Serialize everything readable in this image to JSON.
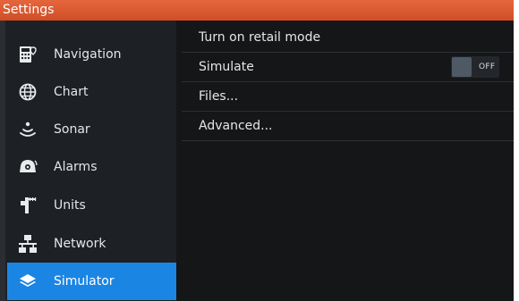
{
  "window": {
    "title": "Settings",
    "accent_color": "#d95a31",
    "selected_color": "#1b85e4"
  },
  "sidebar": {
    "items": [
      {
        "label": "Navigation",
        "icon": "navigation-icon"
      },
      {
        "label": "Chart",
        "icon": "globe-icon"
      },
      {
        "label": "Sonar",
        "icon": "sonar-icon"
      },
      {
        "label": "Alarms",
        "icon": "alarm-bell-icon"
      },
      {
        "label": "Units",
        "icon": "units-ruler-icon"
      },
      {
        "label": "Network",
        "icon": "network-icon"
      },
      {
        "label": "Simulator",
        "icon": "layers-icon",
        "selected": true
      }
    ]
  },
  "main": {
    "rows": [
      {
        "label": "Turn on retail mode"
      },
      {
        "label": "Simulate",
        "toggle_state": "OFF"
      },
      {
        "label": "Files..."
      },
      {
        "label": "Advanced..."
      }
    ]
  }
}
